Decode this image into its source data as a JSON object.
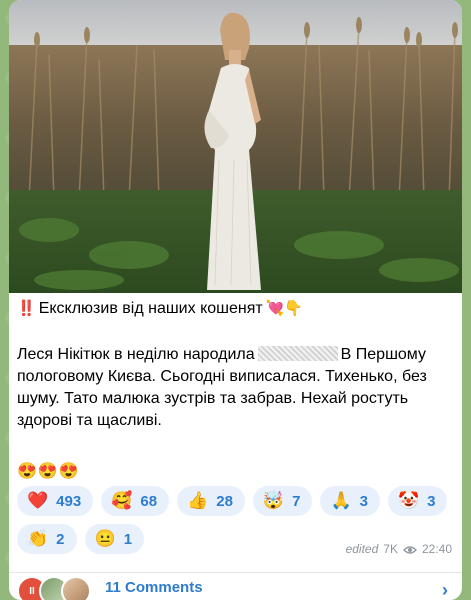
{
  "post": {
    "headline_prefix_emoji": "‼️",
    "headline": "Ексклюзив від наших кошенят",
    "headline_suffix_emoji": "💘👇",
    "body_line1_start": "Леся Нікітюк в неділю народила",
    "body_line1_end": "В",
    "body_rest": "Першому пологовому Києва. Сьогодні виписалася. Тихенько, без шуму. Тато малюка зустрів та забрав. Нехай ростуть здорові та щасливі.",
    "eyes_emojis": "😍😍😍"
  },
  "reactions": [
    {
      "emoji": "❤️",
      "count": "493"
    },
    {
      "emoji": "🥰",
      "count": "68"
    },
    {
      "emoji": "👍",
      "count": "28"
    },
    {
      "emoji": "🤯",
      "count": "7"
    },
    {
      "emoji": "🙏",
      "count": "3"
    },
    {
      "emoji": "🤡",
      "count": "3"
    },
    {
      "emoji": "👏",
      "count": "2"
    },
    {
      "emoji": "😐",
      "count": "1"
    }
  ],
  "meta": {
    "edited": "edited",
    "views": "7K",
    "time": "22:40"
  },
  "comments": {
    "label": "11 Comments"
  },
  "colors": {
    "accent": "#2f7ccf",
    "reaction_bg": "#e8f1fb",
    "chat_bg": "#93b87c"
  },
  "icons": [
    "eye-icon",
    "chevron-right-icon"
  ]
}
